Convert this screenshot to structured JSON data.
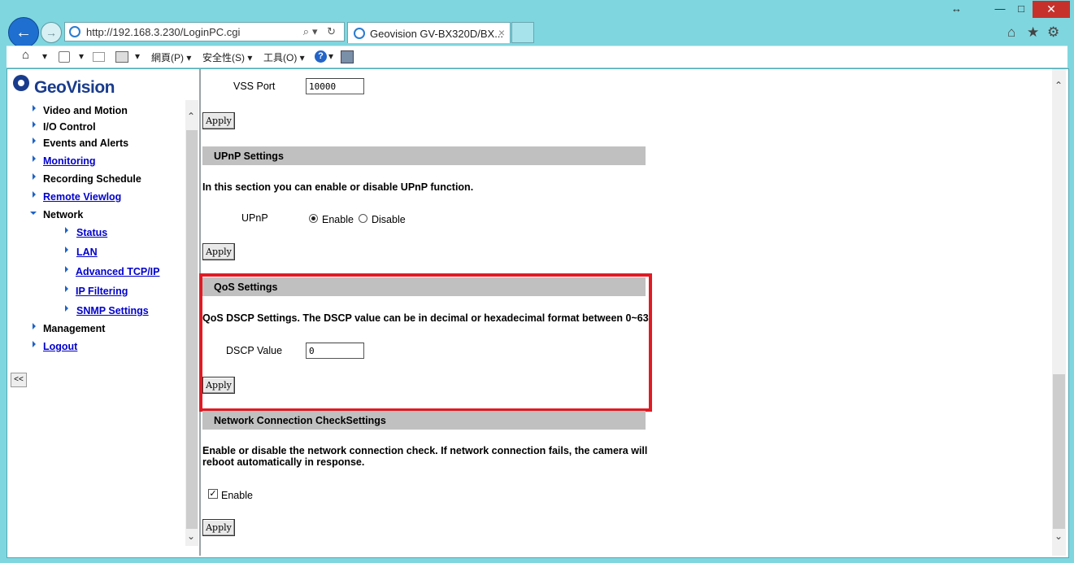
{
  "browser": {
    "address": "http://192.168.3.230/LoginPC.cgi",
    "tab_title": "Geovision GV-BX320D/BX...",
    "tab_close": "×",
    "resize_glyph": "↔",
    "minimize": "—",
    "maximize": "□",
    "close": "✕",
    "back": "←",
    "forward": "→",
    "address_tools": "⌕▾ ↻",
    "home_icon": "⌂",
    "favorites_icon": "★",
    "settings_icon": "⚙"
  },
  "command_bar": {
    "page_menu": "網頁(P)",
    "safety_menu": "安全性(S)",
    "tools_menu": "工具(O)",
    "help_icon": "?",
    "dropdown": "▾"
  },
  "sidebar": {
    "logo": "GeoVision",
    "items": [
      {
        "label": "Video and Motion",
        "link": false
      },
      {
        "label": "I/O Control",
        "link": false
      },
      {
        "label": "Events and Alerts",
        "link": false
      },
      {
        "label": "Monitoring",
        "link": true
      },
      {
        "label": "Recording Schedule",
        "link": false
      },
      {
        "label": "Remote Viewlog",
        "link": true
      },
      {
        "label": "Network",
        "link": false,
        "expanded": true
      },
      {
        "label": "Management",
        "link": false
      },
      {
        "label": "Logout",
        "link": true
      }
    ],
    "network_children": [
      {
        "label": "Status"
      },
      {
        "label": "LAN"
      },
      {
        "label": "Advanced TCP/IP"
      },
      {
        "label": "IP Filtering"
      },
      {
        "label": "SNMP Settings"
      }
    ],
    "collapse_label": "<<"
  },
  "main": {
    "vss_port_label": "VSS Port",
    "vss_port_value": "10000",
    "apply_label": "Apply",
    "upnp": {
      "header": "UPnP Settings",
      "description": "In this section you can enable or disable UPnP function.",
      "label": "UPnP",
      "enable": "Enable",
      "disable": "Disable",
      "selected": "Enable"
    },
    "qos": {
      "header": "QoS Settings",
      "description": "QoS DSCP Settings. The DSCP value can be in decimal or hexadecimal format between 0~63",
      "dscp_label": "DSCP Value",
      "dscp_value": "0"
    },
    "netcheck": {
      "header": "Network Connection CheckSettings",
      "description_line1": "Enable or disable the network connection check. If network connection fails, the camera will",
      "description_line2": "reboot automatically in response.",
      "enable_label": "Enable",
      "enable_checked": true,
      "check_glyph": "✓"
    },
    "scroll_up": "⌃",
    "scroll_down": "⌄"
  },
  "colors": {
    "highlight": "#e01b24",
    "link": "#0000cc",
    "section_header": "#c0c0c0"
  }
}
